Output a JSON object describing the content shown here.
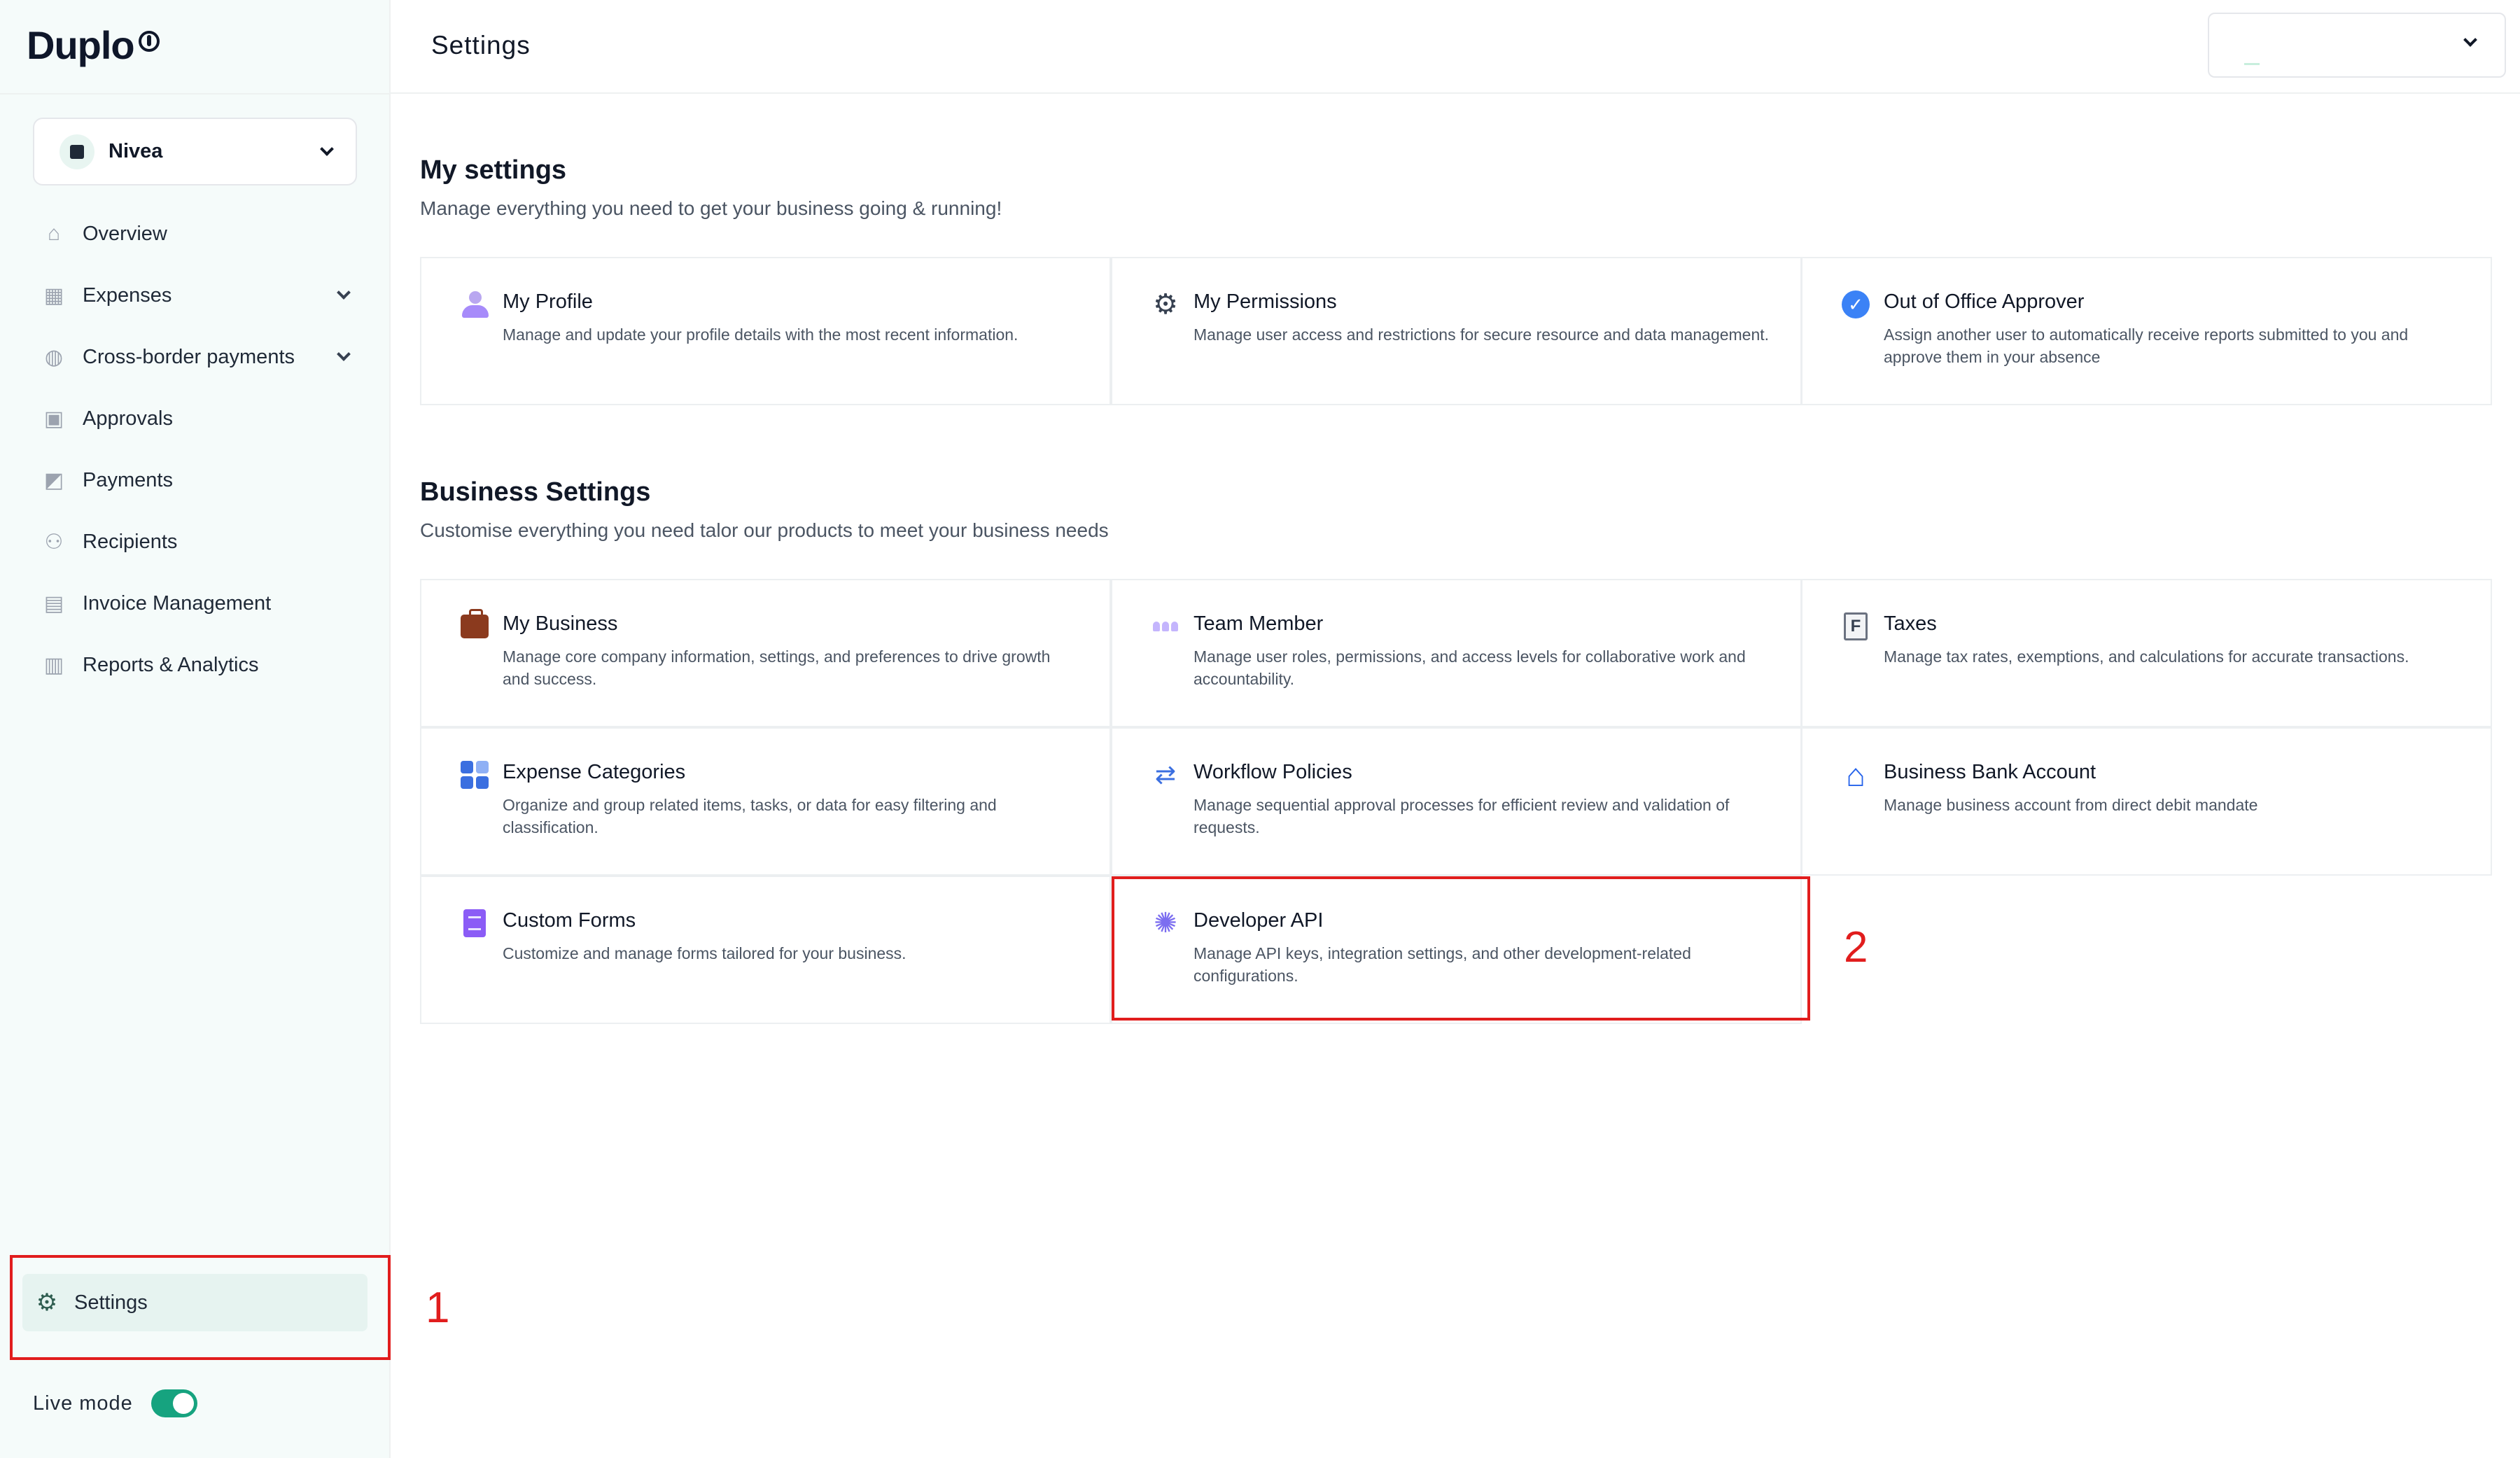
{
  "sidebar": {
    "logo_text": "Duplo",
    "org_name": "Nivea",
    "items": [
      {
        "label": "Overview",
        "icon": "home-icon"
      },
      {
        "label": "Expenses",
        "icon": "grid-icon",
        "expandable": true
      },
      {
        "label": "Cross-border payments",
        "icon": "globe-icon",
        "expandable": true
      },
      {
        "label": "Approvals",
        "icon": "approval-icon"
      },
      {
        "label": "Payments",
        "icon": "payments-icon"
      },
      {
        "label": "Recipients",
        "icon": "recipients-icon"
      },
      {
        "label": "Invoice Management",
        "icon": "invoice-icon"
      },
      {
        "label": "Reports & Analytics",
        "icon": "chart-icon"
      }
    ],
    "settings_label": "Settings",
    "live_mode_label": "Live mode",
    "live_mode_on": true
  },
  "header": {
    "title": "Settings"
  },
  "my_settings": {
    "title": "My settings",
    "subtitle": "Manage everything you need to get your business going & running!",
    "cards": [
      {
        "title": "My Profile",
        "desc": "Manage and update your profile details with the most recent information."
      },
      {
        "title": "My Permissions",
        "desc": "Manage user access and restrictions for secure resource and data management."
      },
      {
        "title": "Out of Office Approver",
        "desc": "Assign another user to automatically receive reports submitted to you and approve them in your absence"
      }
    ]
  },
  "business_settings": {
    "title": "Business Settings",
    "subtitle": "Customise everything you need talor our products to meet your business needs",
    "cards": [
      {
        "title": "My Business",
        "desc": "Manage core company information, settings, and preferences to drive growth and success."
      },
      {
        "title": "Team Member",
        "desc": "Manage user roles, permissions, and access levels for collaborative work and accountability."
      },
      {
        "title": "Taxes",
        "desc": "Manage tax rates, exemptions, and calculations for accurate transactions."
      },
      {
        "title": "Expense Categories",
        "desc": "Organize and group related items, tasks, or data for easy filtering and classification."
      },
      {
        "title": "Workflow Policies",
        "desc": "Manage sequential approval processes for efficient review and validation of requests."
      },
      {
        "title": "Business Bank Account",
        "desc": "Manage business account from direct debit mandate"
      },
      {
        "title": "Custom Forms",
        "desc": "Customize and manage forms tailored for your business."
      },
      {
        "title": "Developer API",
        "desc": "Manage API keys, integration settings, and other development-related configurations."
      }
    ]
  },
  "annotations": {
    "marker_1": "1",
    "marker_2": "2"
  },
  "colors": {
    "accent": "#16a37f",
    "highlight": "#e11d1d",
    "sidebar_bg": "#f5fbfa",
    "settings_active_bg": "#e6f3f0"
  }
}
